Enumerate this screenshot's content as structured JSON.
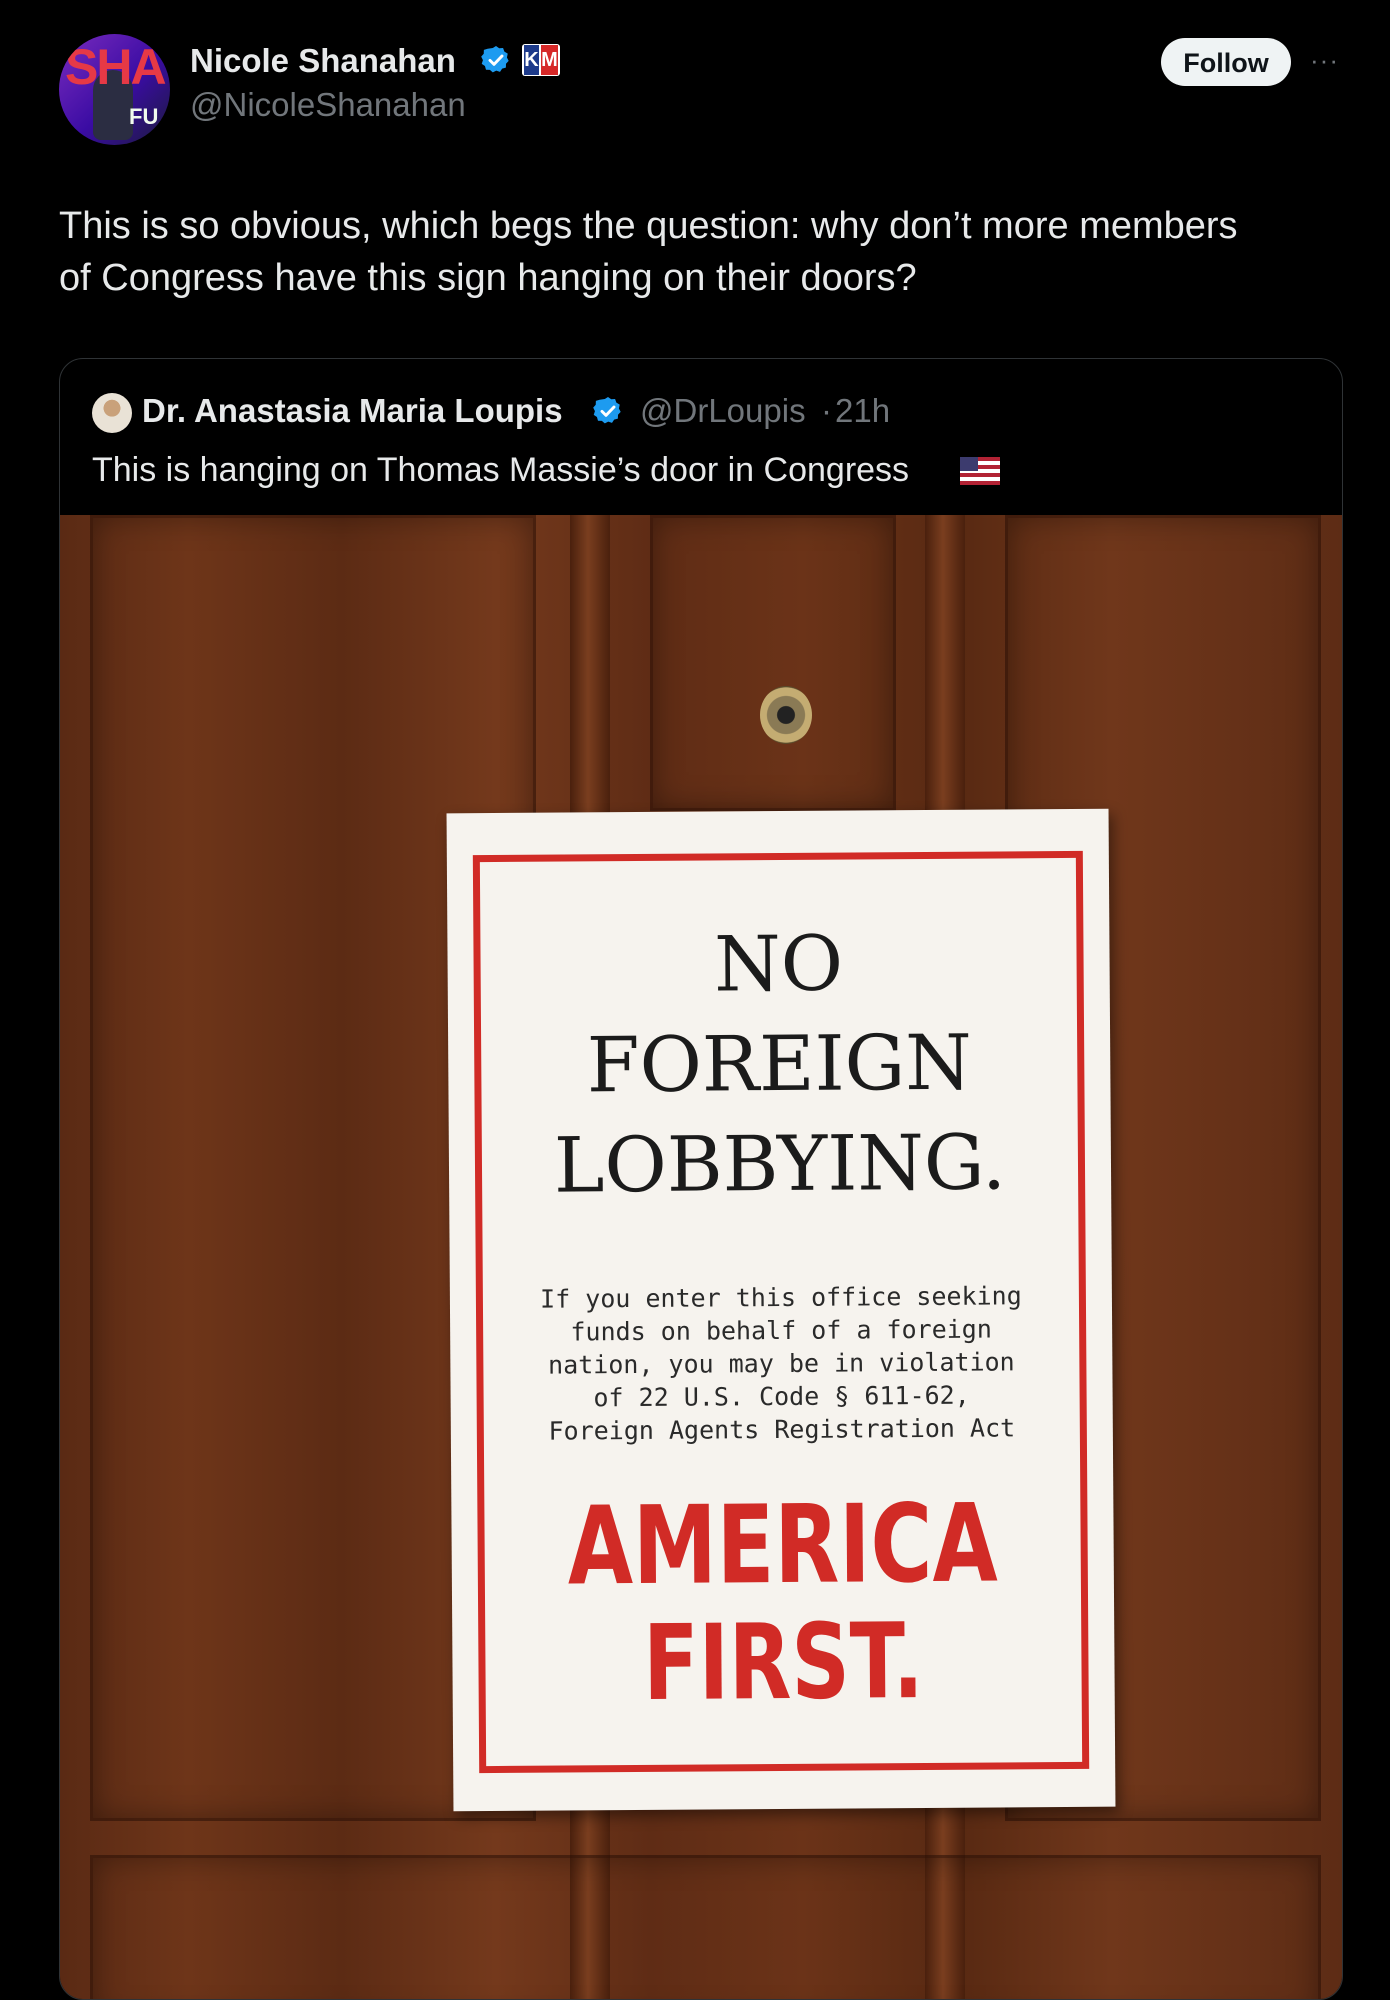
{
  "author": {
    "name": "Nicole Shanahan",
    "handle": "@NicoleShanahan",
    "avatar_text": "SHA",
    "avatar_subtext": "FU",
    "verified_icon": "verified-badge-icon",
    "affiliate_badge": {
      "left": "K",
      "right": "M"
    }
  },
  "follow_label": "Follow",
  "more_label": "···",
  "tweet_text_lines": [
    "This is so obvious, which begs the question: why don’t more members",
    "of Congress have this sign hanging on their doors?"
  ],
  "quote": {
    "name": "Dr. Anastasia Maria Loupis",
    "handle": "@DrLoupis",
    "separator": "·",
    "time": "21h",
    "text": "This is hanging on Thomas Massie’s door in Congress",
    "emoji": "us-flag-icon"
  },
  "sign": {
    "headline": [
      "NO",
      "FOREIGN",
      "LOBBYING."
    ],
    "body_lines": [
      "If you enter this office seeking",
      "funds on behalf of a foreign",
      "nation, you may be in violation",
      "of 22 U.S. Code § 611-62,",
      "Foreign Agents Registration Act"
    ],
    "slogan": [
      "AMERICA",
      "FIRST."
    ]
  },
  "colors": {
    "background": "#000000",
    "text": "#e7e9ea",
    "muted": "#71767b",
    "verified": "#1d9bf0",
    "sign_red": "#d12b26"
  }
}
